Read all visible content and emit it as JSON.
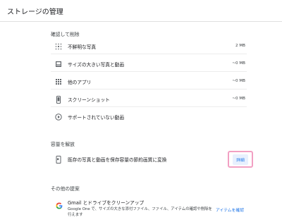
{
  "header": {
    "title": "ストレージの管理"
  },
  "review": {
    "title": "確認して削除",
    "items": [
      {
        "label": "不鮮明な写真",
        "size": "2 MB",
        "icon": "blurry-photos-icon"
      },
      {
        "label": "サイズの大きい写真と動画",
        "size": "~0 MB",
        "icon": "large-media-icon"
      },
      {
        "label": "他のアプリ",
        "size": "~0 MB",
        "icon": "apps-grid-icon"
      },
      {
        "label": "スクリーンショット",
        "size": "~0 MB",
        "icon": "phone-screenshot-icon"
      },
      {
        "label": "サポートされていない動画",
        "size": "",
        "icon": "play-circle-icon"
      }
    ]
  },
  "free_up": {
    "title": "容量を解放",
    "item_label": "既存の写真と動画を保存容量の節約画質に変換",
    "details_label": "詳細",
    "highlight_color": "#f2a0c3"
  },
  "other": {
    "title": "その他の提案",
    "gmail_title": "Gmail とドライブをクリーンアップ",
    "gmail_desc": "Google One で、サイズの大きな添付ファイル、ファイル、アイテムの確認や削除を行えます",
    "review_link": "アイテムを確認"
  },
  "colors": {
    "accent": "#1a73e8",
    "accent_bg": "#e8f0fe",
    "divider": "#ececec"
  }
}
